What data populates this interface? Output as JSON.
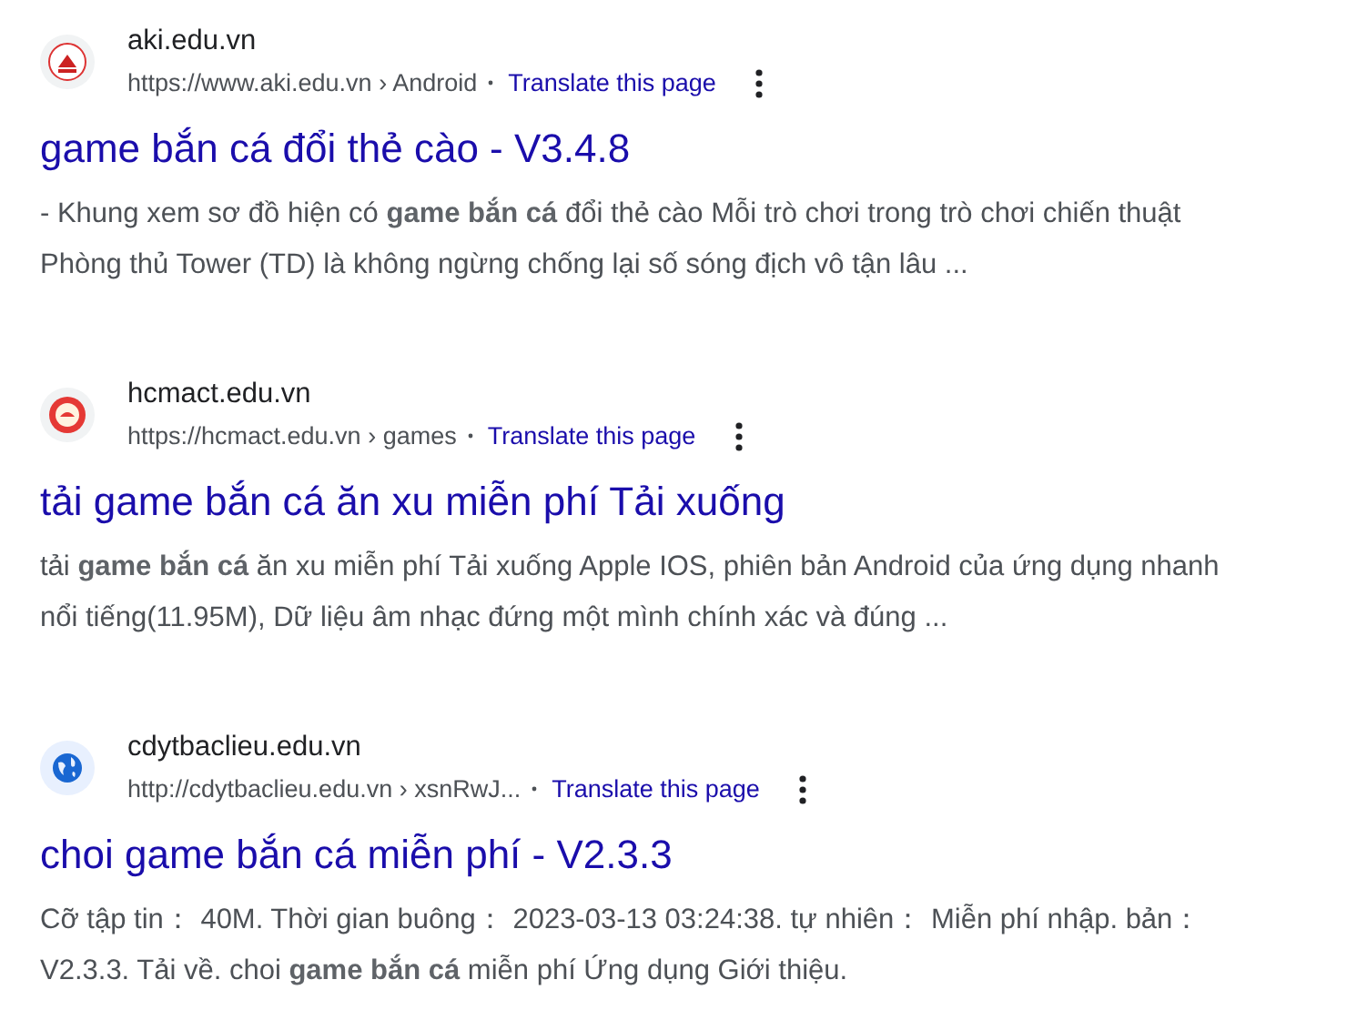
{
  "results": [
    {
      "favicon": {
        "kind": "crest"
      },
      "site": "aki.edu.vn",
      "url": "https://www.aki.edu.vn › Android",
      "translate": "Translate this page",
      "title": "game bắn cá đổi thẻ cào - V3.4.8",
      "snippet": "- Khung xem sơ đồ hiện có **game bắn cá** đổi thẻ cào Mỗi trò chơi trong trò chơi chiến thuật\nPhòng thủ Tower (TD) là không ngừng chống lại số sóng địch vô tận lâu ..."
    },
    {
      "favicon": {
        "kind": "seal"
      },
      "site": "hcmact.edu.vn",
      "url": "https://hcmact.edu.vn › games",
      "translate": "Translate this page",
      "title": "tải game bắn cá ăn xu miễn phí Tải xuống",
      "snippet": "tải **game bắn cá** ăn xu miễn phí Tải xuống Apple IOS, phiên bản Android của ứng dụng nhanh\nnổi tiếng(11.95M),  Dữ liệu âm nhạc đứng một mình chính xác và đúng ..."
    },
    {
      "favicon": {
        "kind": "globe"
      },
      "site": "cdytbaclieu.edu.vn",
      "url": "http://cdytbaclieu.edu.vn › xsnRwJ...",
      "translate": "Translate this page",
      "title": "choi game bắn cá miễn phí - V2.3.3",
      "snippet": "Cỡ tập tin： 40M. Thời gian buông： 2023-03-13 03:24:38. tự nhiên： Miễn phí nhập. bản：\nV2.3.3. Tải về. choi **game bắn cá** miễn phí Ứng dụng Giới thiệu."
    }
  ]
}
